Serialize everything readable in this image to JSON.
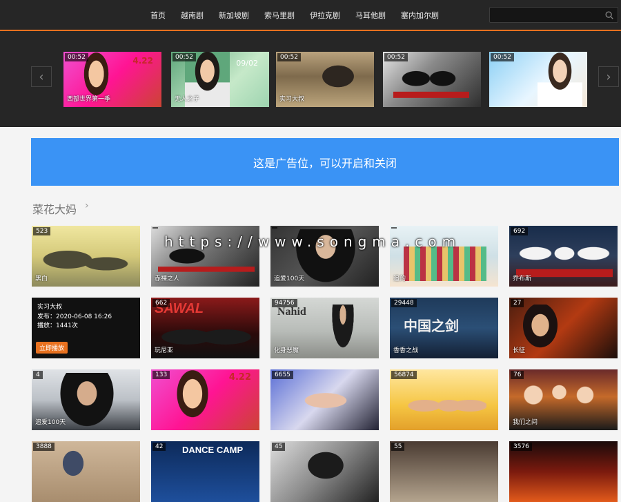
{
  "nav": {
    "items": [
      "首页",
      "越南剧",
      "新加坡剧",
      "索马里剧",
      "伊拉克剧",
      "马耳他剧",
      "塞内加尔剧"
    ]
  },
  "search": {
    "value": "",
    "placeholder": ""
  },
  "slider": {
    "prev_icon": "chevron-left-icon",
    "next_icon": "chevron-right-icon",
    "slides": [
      {
        "duration": "00:52",
        "caption": "西部世界第一季",
        "tag": "4.22"
      },
      {
        "duration": "00:52",
        "caption": "无人之子",
        "tag": "09/02"
      },
      {
        "duration": "00:52",
        "caption": "实习大叔",
        "tag": ""
      },
      {
        "duration": "00:52",
        "caption": "",
        "tag": ""
      },
      {
        "duration": "00:52",
        "caption": "",
        "tag": ""
      }
    ]
  },
  "ad": {
    "text": "这是广告位，可以开启和关闭"
  },
  "section": {
    "title": "菜花大妈",
    "more": "›"
  },
  "watermark": "https://www.songma.com",
  "grid": [
    {
      "count": "523",
      "caption": "黑白"
    },
    {
      "count": "",
      "caption": "赤裸之人"
    },
    {
      "count": "",
      "caption": "追爱100天"
    },
    {
      "count": "",
      "caption": "追的"
    },
    {
      "count": "692",
      "caption": "乔布斯"
    },
    {
      "count": "",
      "caption": "",
      "hover": {
        "title": "实习大叔",
        "date": "发布：2020-06-08 16:26",
        "plays": "播放：1441次"
      },
      "button": "立即播放"
    },
    {
      "count": "662",
      "caption": "玩尼亚"
    },
    {
      "count": "94756",
      "caption": "化身恶魔"
    },
    {
      "count": "29448",
      "caption": "香香之战"
    },
    {
      "count": "27",
      "caption": "长征"
    },
    {
      "count": "4",
      "caption": "追爱100天"
    },
    {
      "count": "133",
      "caption": "",
      "tag": "4.22"
    },
    {
      "count": "6655",
      "caption": ""
    },
    {
      "count": "56874",
      "caption": ""
    },
    {
      "count": "76",
      "caption": "我们之间"
    },
    {
      "count": "3888",
      "caption": ""
    },
    {
      "count": "42",
      "caption": "",
      "title_art": "DANCE CAMP"
    },
    {
      "count": "45",
      "caption": ""
    },
    {
      "count": "55",
      "caption": ""
    },
    {
      "count": "3576",
      "caption": ""
    }
  ]
}
